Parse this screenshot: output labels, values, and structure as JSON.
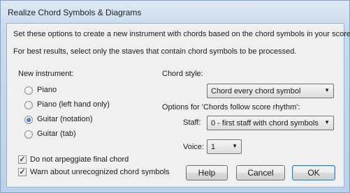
{
  "window": {
    "title": "Realize Chord Symbols & Diagrams"
  },
  "intro": {
    "line1": "Set these options to create a new instrument with chords based on the chord symbols in your score.",
    "line2": "For best results, select only the staves that contain chord symbols to be processed."
  },
  "new_instrument": {
    "label": "New instrument:",
    "options": [
      {
        "label": "Piano",
        "selected": false
      },
      {
        "label": "Piano (left hand only)",
        "selected": false
      },
      {
        "label": "Guitar (notation)",
        "selected": true
      },
      {
        "label": "Guitar (tab)",
        "selected": false
      }
    ]
  },
  "chord_style": {
    "label": "Chord style:",
    "value": "Chord every chord symbol"
  },
  "rhythm_options": {
    "label": "Options for 'Chords follow score rhythm':",
    "staff_label": "Staff:",
    "staff_value": "0 - first staff with chord symbols",
    "voice_label": "Voice:",
    "voice_value": "1"
  },
  "checkboxes": [
    {
      "label": "Do not arpeggiate final chord",
      "checked": true
    },
    {
      "label": "Warn about unrecognized chord symbols",
      "checked": true
    }
  ],
  "buttons": {
    "help": "Help",
    "cancel": "Cancel",
    "ok": "OK"
  }
}
